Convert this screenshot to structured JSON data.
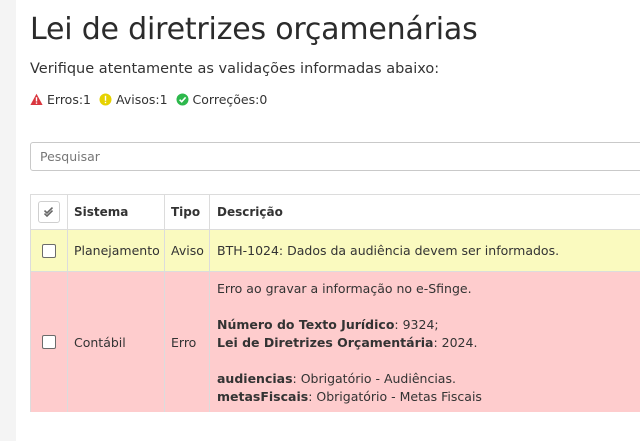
{
  "page": {
    "title": "Lei de diretrizes orçamenárias",
    "subtitle": "Verifique atentamente as validações informadas abaixo:"
  },
  "summary": {
    "errors_label": "Erros:1",
    "warnings_label": "Avisos:1",
    "fixes_label": "Correções:0",
    "colors": {
      "error": "#d9363e",
      "warning": "#e6d200",
      "fix": "#2db84c"
    }
  },
  "search": {
    "placeholder": "Pesquisar",
    "value": ""
  },
  "table": {
    "headers": {
      "system": "Sistema",
      "type": "Tipo",
      "description": "Descrição"
    },
    "rows": [
      {
        "system": "Planejamento",
        "type": "Aviso",
        "description": "BTH-1024: Dados da audiência devem ser informados.",
        "color": "#fafabf"
      },
      {
        "system": "Contábil",
        "type": "Erro",
        "color": "#fecccd",
        "description": {
          "line1": "Erro ao gravar a informação no e-Sfinge.",
          "field1_name": "Número do Texto Jurídico",
          "field1_value": ": 9324;",
          "field2_name": "Lei de Diretrizes Orçamentária",
          "field2_value": ": 2024.",
          "field3_name": "audiencias",
          "field3_value": ": Obrigatório - Audiências.",
          "field4_name": "metasFiscais",
          "field4_value": ": Obrigatório - Metas Fiscais"
        }
      }
    ]
  }
}
